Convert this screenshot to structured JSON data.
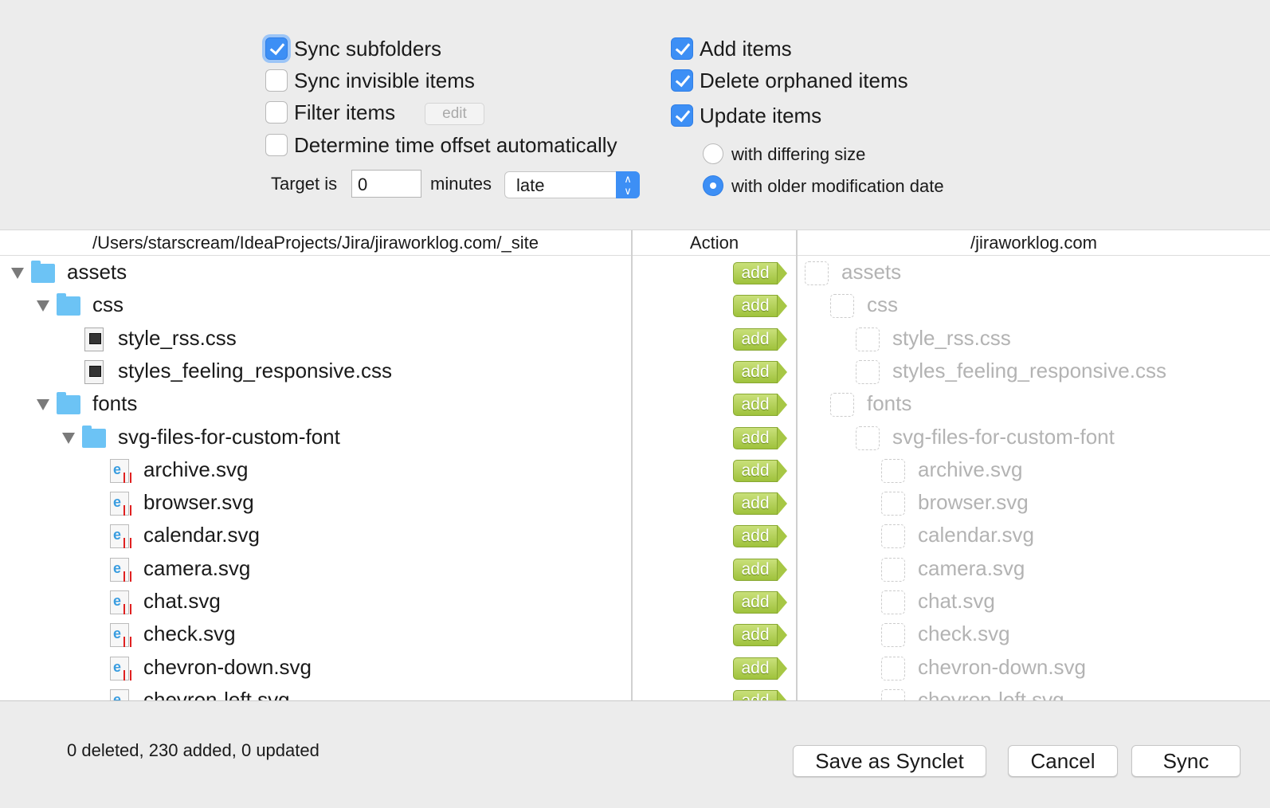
{
  "options": {
    "sync_subfolders": {
      "label": "Sync subfolders",
      "checked": true
    },
    "sync_invisible": {
      "label": "Sync invisible items",
      "checked": false
    },
    "filter_items": {
      "label": "Filter items",
      "checked": false,
      "edit_label": "edit"
    },
    "time_offset": {
      "label": "Determine time offset automatically",
      "checked": false
    },
    "target_is_label": "Target is",
    "minutes_value": "0",
    "minutes_label": "minutes",
    "late_select": "late",
    "add_items": {
      "label": "Add items",
      "checked": true
    },
    "delete_orphaned": {
      "label": "Delete orphaned items",
      "checked": true
    },
    "update_items": {
      "label": "Update items",
      "checked": true
    },
    "differing_size": {
      "label": "with differing size",
      "selected": false
    },
    "older_date": {
      "label": "with older modification date",
      "selected": true
    }
  },
  "list": {
    "source_header": "/Users/starscream/IdeaProjects/Jira/jiraworklog.com/_site",
    "action_header": "Action",
    "target_header": "/jiraworklog.com",
    "action_label": "add",
    "rows": [
      {
        "name": "assets",
        "type": "folder",
        "depth": 0
      },
      {
        "name": "css",
        "type": "folder",
        "depth": 1
      },
      {
        "name": "style_rss.css",
        "type": "css",
        "depth": 2
      },
      {
        "name": "styles_feeling_responsive.css",
        "type": "css",
        "depth": 2
      },
      {
        "name": "fonts",
        "type": "folder",
        "depth": 1
      },
      {
        "name": "svg-files-for-custom-font",
        "type": "folder",
        "depth": 2
      },
      {
        "name": "archive.svg",
        "type": "svg",
        "depth": 3
      },
      {
        "name": "browser.svg",
        "type": "svg",
        "depth": 3
      },
      {
        "name": "calendar.svg",
        "type": "svg",
        "depth": 3
      },
      {
        "name": "camera.svg",
        "type": "svg",
        "depth": 3
      },
      {
        "name": "chat.svg",
        "type": "svg",
        "depth": 3
      },
      {
        "name": "check.svg",
        "type": "svg",
        "depth": 3
      },
      {
        "name": "chevron-down.svg",
        "type": "svg",
        "depth": 3
      },
      {
        "name": "chevron-left.svg",
        "type": "svg",
        "depth": 3
      }
    ]
  },
  "footer": {
    "status": "0 deleted, 230 added, 0 updated",
    "save_synclet": "Save as Synclet",
    "cancel": "Cancel",
    "sync": "Sync"
  }
}
